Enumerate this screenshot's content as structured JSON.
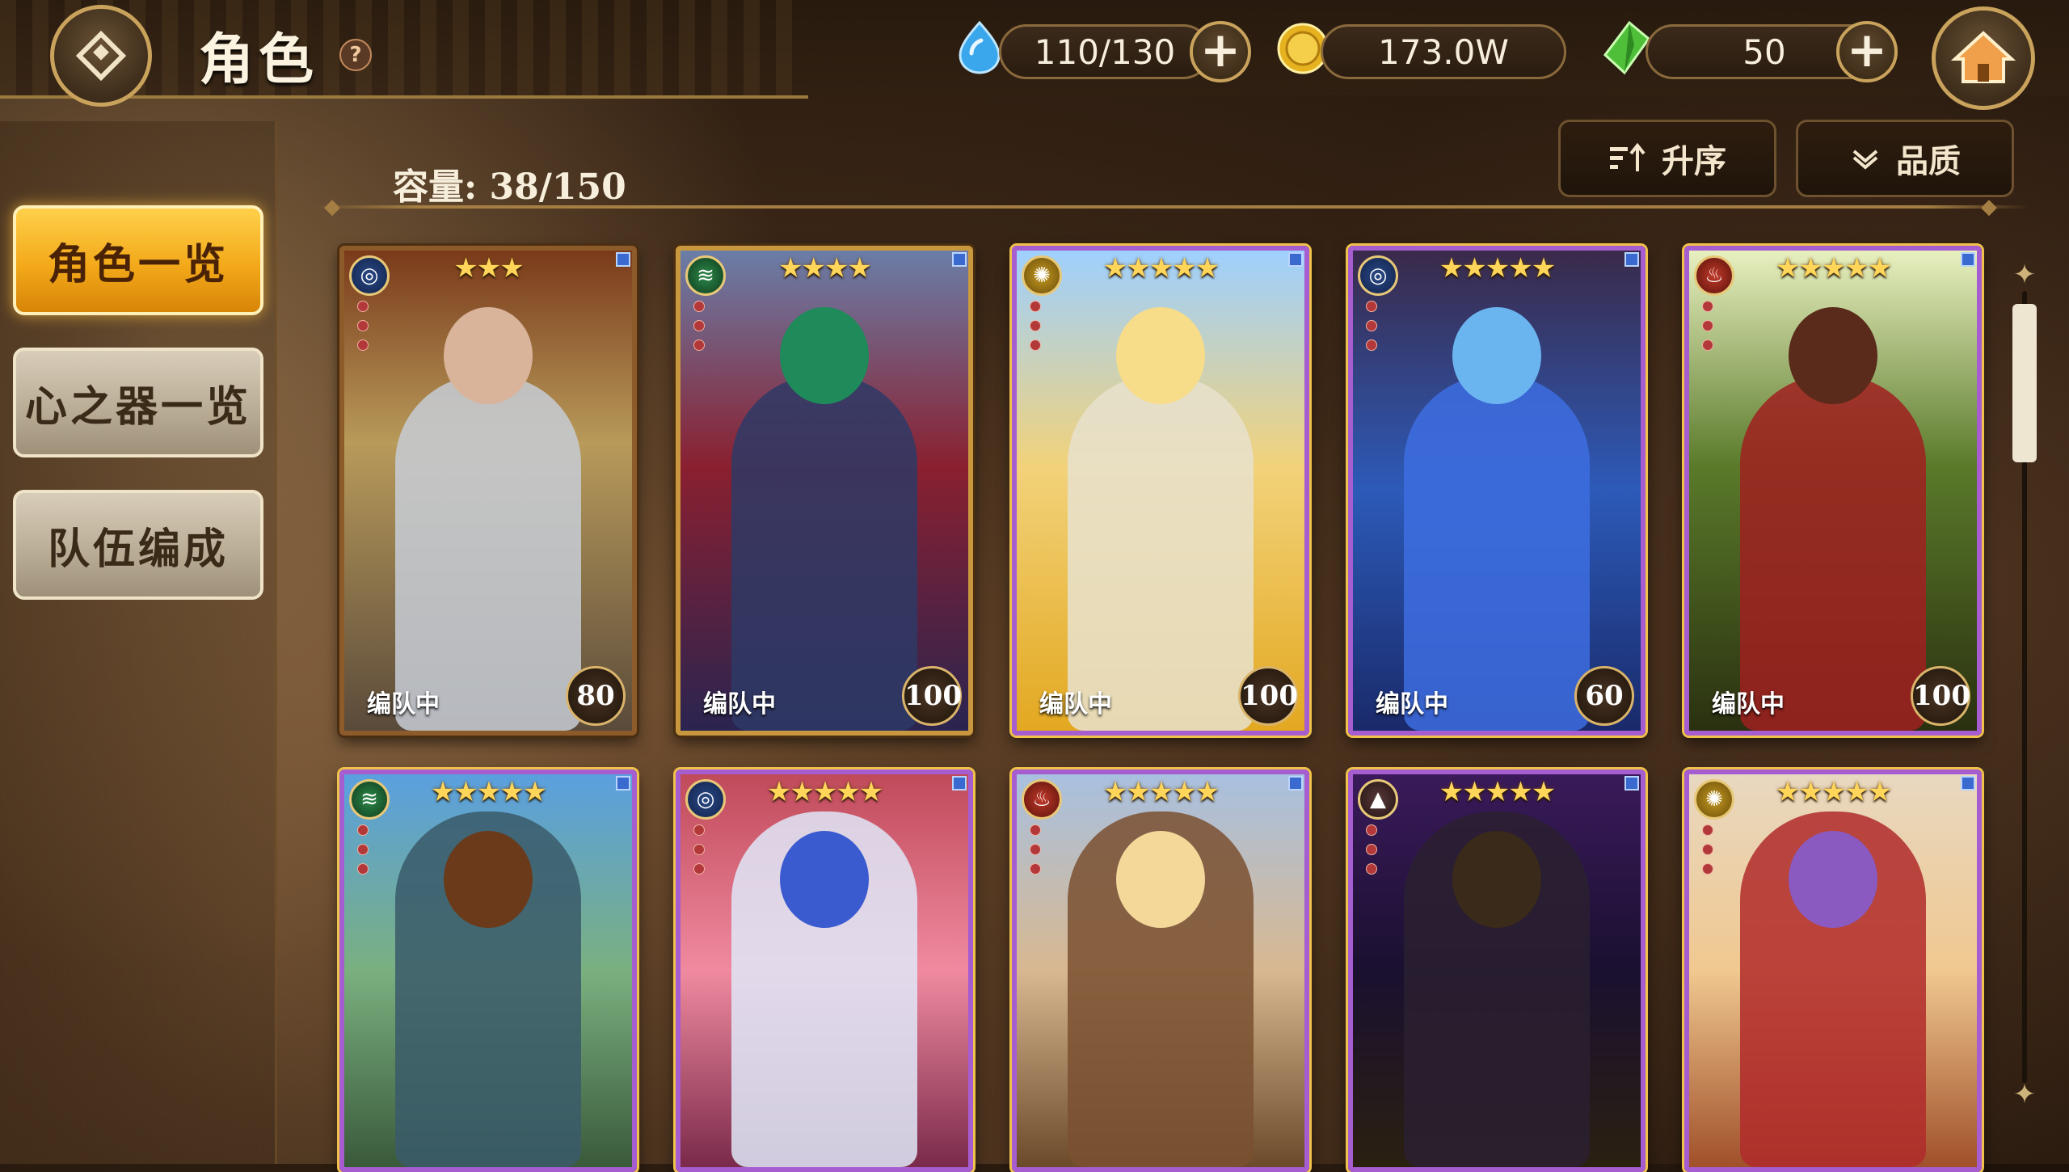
{
  "header": {
    "title": "角色",
    "help_icon": "question-icon",
    "resources": [
      {
        "name": "stamina",
        "icon": "water-drop-icon",
        "value": "110/130",
        "has_plus": true
      },
      {
        "name": "gold",
        "icon": "coin-icon",
        "value": "173.0W",
        "has_plus": false
      },
      {
        "name": "gems",
        "icon": "green-crystal-icon",
        "value": "50",
        "has_plus": true
      }
    ],
    "plus_label": "+",
    "home_icon": "home-icon"
  },
  "sidebar": {
    "items": [
      {
        "label": "角色一览",
        "active": true
      },
      {
        "label": "心之器一览",
        "active": false
      },
      {
        "label": "队伍编成",
        "active": false
      }
    ]
  },
  "content": {
    "capacity": "容量: 38/150",
    "sort_label": "升序",
    "filter_label": "品质"
  },
  "cards": [
    {
      "element": "water",
      "stars": "★★★",
      "rarity": "3",
      "label": "编队中",
      "level": "80",
      "theme": "knight"
    },
    {
      "element": "wind",
      "stars": "★★★★",
      "rarity": "4",
      "label": "编队中",
      "level": "100",
      "theme": "green-hair"
    },
    {
      "element": "light",
      "stars": "★★★★★",
      "rarity": "5",
      "label": "编队中",
      "level": "100",
      "theme": "blonde"
    },
    {
      "element": "water",
      "stars": "★★★★★",
      "rarity": "5",
      "label": "编队中",
      "level": "60",
      "theme": "blue-hair"
    },
    {
      "element": "fire",
      "stars": "★★★★★",
      "rarity": "5",
      "label": "编队中",
      "level": "100",
      "theme": "witch"
    },
    {
      "element": "wind",
      "stars": "★★★★★",
      "rarity": "5",
      "label": "",
      "level": "",
      "theme": "archer"
    },
    {
      "element": "water",
      "stars": "★★★★★",
      "rarity": "5",
      "label": "",
      "level": "",
      "theme": "pink"
    },
    {
      "element": "fire",
      "stars": "★★★★★",
      "rarity": "5",
      "label": "",
      "level": "",
      "theme": "detective"
    },
    {
      "element": "dark",
      "stars": "★★★★★",
      "rarity": "5",
      "label": "",
      "level": "",
      "theme": "dark-sword"
    },
    {
      "element": "light",
      "stars": "★★★★★",
      "rarity": "5",
      "label": "",
      "level": "",
      "theme": "purple-hair"
    }
  ],
  "colors": {
    "accent_gold": "#f3a91a",
    "frame_purple": "#a55dd0",
    "frame_bronze": "#8d5a2a"
  }
}
